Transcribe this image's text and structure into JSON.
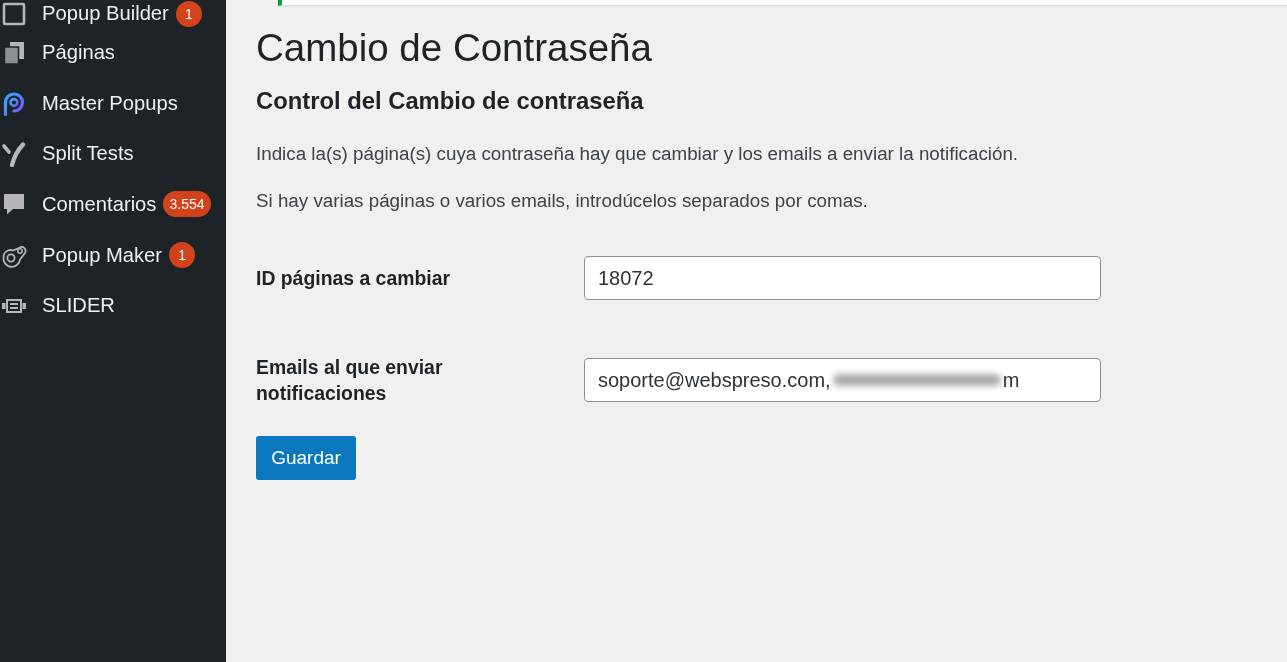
{
  "sidebar": {
    "items": [
      {
        "label": "Popup Builder",
        "badge": "1"
      },
      {
        "label": "Páginas"
      },
      {
        "label": "Master Popups"
      },
      {
        "label": "Split Tests"
      },
      {
        "label": "Comentarios",
        "badge": "3.554"
      },
      {
        "label": "Popup Maker",
        "badge": "1"
      },
      {
        "label": "SLIDER"
      }
    ]
  },
  "notice": {
    "kind": "success"
  },
  "page": {
    "title": "Cambio de Contraseña",
    "section_title": "Control del Cambio de contraseña",
    "paragraphs": [
      "Indica la(s) página(s) cuya contraseña hay que cambiar y los emails a enviar la notificación.",
      "Si hay varias páginas o varios emails, introdúcelos separados por comas."
    ],
    "fields": [
      {
        "label": "ID páginas a cambiar",
        "value": "18072"
      },
      {
        "label": "Emails al que enviar notificaciones",
        "value": "soporte@webspreso.com,",
        "redacted": true,
        "value_tail": "m"
      }
    ],
    "button": "Guardar"
  }
}
